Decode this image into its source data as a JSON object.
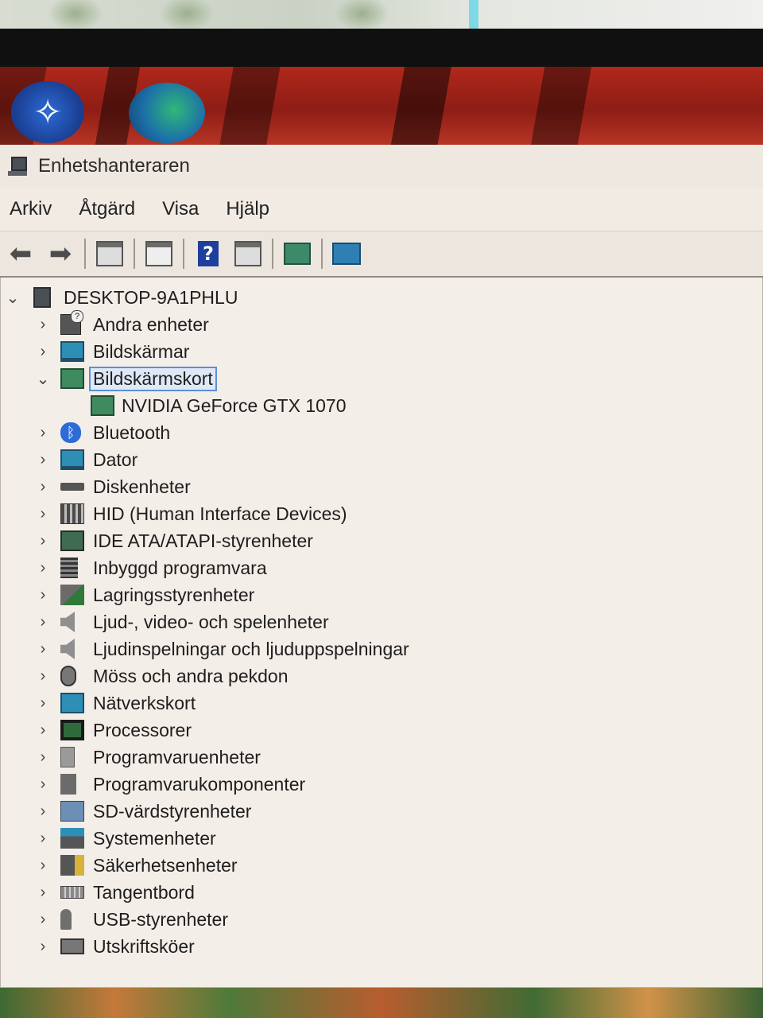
{
  "window": {
    "title": "Enhetshanteraren"
  },
  "menu": {
    "items": [
      "Arkiv",
      "Åtgärd",
      "Visa",
      "Hjälp"
    ]
  },
  "toolbar": {
    "icons": [
      "back-arrow-icon",
      "forward-arrow-icon",
      "show-hide-tree-icon",
      "properties-icon",
      "help-icon",
      "action-pane-icon",
      "update-driver-icon",
      "scan-hardware-icon"
    ]
  },
  "tree": {
    "root": "DESKTOP-9A1PHLU",
    "categories": [
      {
        "label": "Andra enheter",
        "icon": "other-devices-icon"
      },
      {
        "label": "Bildskärmar",
        "icon": "monitor-icon"
      },
      {
        "label": "Bildskärmskort",
        "icon": "display-adapter-icon",
        "expanded": true,
        "selected": true,
        "children": [
          "NVIDIA GeForce GTX 1070"
        ]
      },
      {
        "label": "Bluetooth",
        "icon": "bluetooth-icon"
      },
      {
        "label": "Dator",
        "icon": "computer-icon"
      },
      {
        "label": "Diskenheter",
        "icon": "disk-drive-icon"
      },
      {
        "label": "HID (Human Interface Devices)",
        "icon": "hid-icon"
      },
      {
        "label": "IDE ATA/ATAPI-styrenheter",
        "icon": "ide-controller-icon"
      },
      {
        "label": "Inbyggd programvara",
        "icon": "firmware-icon"
      },
      {
        "label": "Lagringsstyrenheter",
        "icon": "storage-controller-icon"
      },
      {
        "label": "Ljud-, video- och spelenheter",
        "icon": "sound-icon"
      },
      {
        "label": "Ljudinspelningar och ljuduppspelningar",
        "icon": "audio-io-icon"
      },
      {
        "label": "Möss och andra pekdon",
        "icon": "mouse-icon"
      },
      {
        "label": "Nätverkskort",
        "icon": "network-adapter-icon"
      },
      {
        "label": "Processorer",
        "icon": "processor-icon"
      },
      {
        "label": "Programvaruenheter",
        "icon": "software-device-icon"
      },
      {
        "label": "Programvarukomponenter",
        "icon": "software-component-icon"
      },
      {
        "label": "SD-värdstyrenheter",
        "icon": "sd-host-icon"
      },
      {
        "label": "Systemenheter",
        "icon": "system-device-icon"
      },
      {
        "label": "Säkerhetsenheter",
        "icon": "security-device-icon"
      },
      {
        "label": "Tangentbord",
        "icon": "keyboard-icon"
      },
      {
        "label": "USB-styrenheter",
        "icon": "usb-icon"
      },
      {
        "label": "Utskriftsköer",
        "icon": "print-queue-icon"
      }
    ]
  }
}
